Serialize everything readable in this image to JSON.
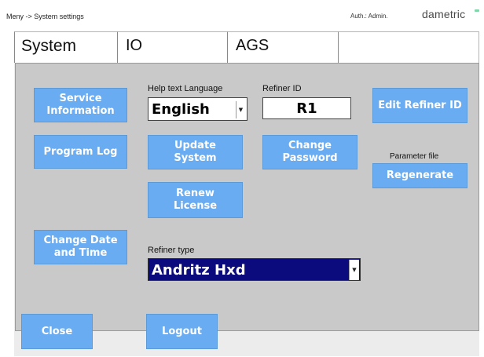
{
  "header": {
    "breadcrumb": "Meny -> System settings",
    "auth": "Auth.: Admin.",
    "brand": "dametric"
  },
  "tabs": [
    {
      "label": "System",
      "active": true
    },
    {
      "label": "IO",
      "active": false
    },
    {
      "label": "AGS",
      "active": false
    }
  ],
  "buttons": {
    "service_information": "Service\nInformation",
    "program_log": "Program Log",
    "change_date_time": "Change Date\nand Time",
    "update_system": "Update\nSystem",
    "renew_license": "Renew\nLicense",
    "change_password": "Change\nPassword",
    "edit_refiner_id": "Edit Refiner ID",
    "regenerate": "Regenerate",
    "close": "Close",
    "logout": "Logout"
  },
  "help_language": {
    "label": "Help text Language",
    "value": "English"
  },
  "refiner_id": {
    "label": "Refiner ID",
    "value": "R1"
  },
  "parameter_file": {
    "label": "Parameter file"
  },
  "refiner_type": {
    "label": "Refiner type",
    "value": "Andritz Hxd"
  },
  "colors": {
    "button": "#6aacf1",
    "panel": "#c9c9c9",
    "selected_dropdown": "#0b0b7d"
  }
}
